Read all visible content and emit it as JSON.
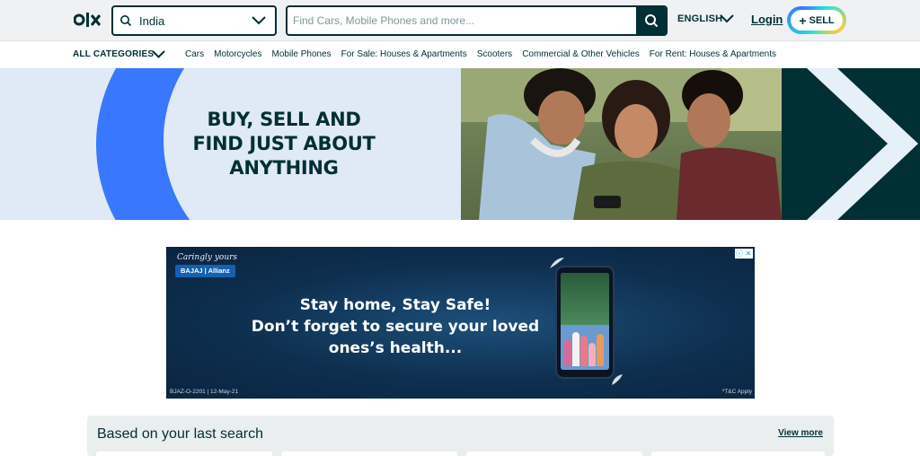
{
  "header": {
    "location_value": "India",
    "search_placeholder": "Find Cars, Mobile Phones and more...",
    "language": "ENGLISH",
    "login": "Login",
    "sell_label": "SELL",
    "sell_plus": "+"
  },
  "categories": {
    "all_label": "ALL CATEGORIES",
    "items": [
      "Cars",
      "Motorcycles",
      "Mobile Phones",
      "For Sale: Houses & Apartments",
      "Scooters",
      "Commercial & Other Vehicles",
      "For Rent: Houses & Apartments"
    ]
  },
  "hero": {
    "lines": [
      "BUY, SELL AND",
      "FIND JUST ABOUT",
      "ANYTHING"
    ]
  },
  "ad": {
    "tagline": "Caringly yours",
    "brand": "BAJAJ | Allianz",
    "headline_lines": [
      "Stay home, Stay Safe!",
      "Don’t forget to secure your loved",
      "ones’s health..."
    ],
    "code": "BJAZ-O-2201 | 12-May-21",
    "tnc": "*T&C Apply"
  },
  "last_search": {
    "title": "Based on your last search",
    "view_more": "View more"
  },
  "colors": {
    "brand_dark": "#002f34",
    "accent_blue": "#3a77ff",
    "header_bg": "#eff1f3"
  },
  "icons": [
    "olx-logo",
    "search-icon",
    "chevron-down-icon",
    "plus-icon",
    "adchoices-icon"
  ]
}
